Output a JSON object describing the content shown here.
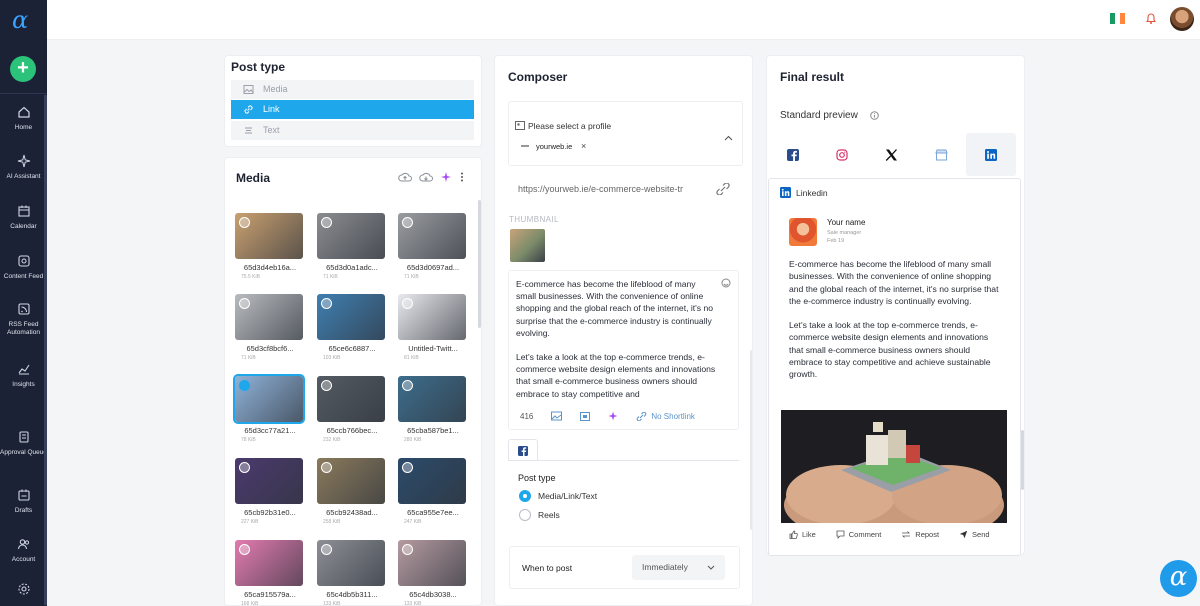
{
  "sidebar": {
    "add_symbol": "+",
    "items": [
      {
        "label": "Home",
        "icon": "home-icon"
      },
      {
        "label": "AI Assistant",
        "icon": "sparkle-icon"
      },
      {
        "label": "Calendar",
        "icon": "calendar-icon"
      },
      {
        "label": "Content Feed",
        "icon": "feed-icon"
      },
      {
        "label": "RSS Feed Automation",
        "icon": "rss-icon"
      },
      {
        "label": "Insights",
        "icon": "chart-icon"
      },
      {
        "label": "Approval Queue",
        "icon": "approval-icon"
      },
      {
        "label": "Drafts",
        "icon": "drafts-icon"
      },
      {
        "label": "Account",
        "icon": "account-icon"
      }
    ]
  },
  "post_type": {
    "title": "Post type",
    "options": [
      {
        "label": "Media",
        "active": false
      },
      {
        "label": "Link",
        "active": true
      },
      {
        "label": "Text",
        "active": false
      }
    ]
  },
  "media": {
    "title": "Media",
    "items": [
      {
        "name": "65d3d4eb16a...",
        "size": "75.5 KiB",
        "color": "#c9a070"
      },
      {
        "name": "65d3d0a1adc...",
        "size": "71 KiB",
        "color": "#8a8c90"
      },
      {
        "name": "65d3d0697ad...",
        "size": "71 KiB",
        "color": "#9a9ca0"
      },
      {
        "name": "65d3cf8bcf6...",
        "size": "71 KiB",
        "color": "#b8bbbf"
      },
      {
        "name": "65ce6c6887...",
        "size": "103 KiB",
        "color": "#3f7fb0"
      },
      {
        "name": "Untitled-Twitt...",
        "size": "81 KiB",
        "color": "#e9e9ee"
      },
      {
        "name": "65d3cc77a21...",
        "size": "78 KiB",
        "color": "#8fb2d8",
        "selected": true
      },
      {
        "name": "65ccb766bec...",
        "size": "232 KiB",
        "color": "#555b63"
      },
      {
        "name": "65cba587be1...",
        "size": "280 KiB",
        "color": "#3d6d8c"
      },
      {
        "name": "65cb92b31e0...",
        "size": "227 KiB",
        "color": "#4b3a6e"
      },
      {
        "name": "65cb92438ad...",
        "size": "258 KiB",
        "color": "#8a7a5c"
      },
      {
        "name": "65ca955e7ee...",
        "size": "247 KiB",
        "color": "#2c4b6a"
      },
      {
        "name": "65ca915579a...",
        "size": "168 KiB",
        "color": "#e27bb0"
      },
      {
        "name": "65c4db5b311...",
        "size": "133 KiB",
        "color": "#8c8f95"
      },
      {
        "name": "65c4db3038...",
        "size": "133 KiB",
        "color": "#b49aa0"
      }
    ]
  },
  "composer": {
    "title": "Composer",
    "profile_prompt": "Please select a profile",
    "profile_chip": "yourweb.ie",
    "chip_remove": "×",
    "url": "https://yourweb.ie/e-commerce-website-tr",
    "thumbnail_label": "THUMBNAIL",
    "text_paragraphs": [
      "E-commerce has become the lifeblood of many small businesses. With the convenience of online shopping and the global reach of the internet, it's no surprise that the e-commerce industry is continually evolving.",
      "Let's take a look at the top e-commerce trends, e-commerce website design elements and innovations that small e-commerce business owners should embrace to stay competitive and"
    ],
    "char_count": "416",
    "shortlink_label": "No Shortlink",
    "post_type_label": "Post type",
    "post_type_options": [
      {
        "label": "Media/Link/Text",
        "selected": true
      },
      {
        "label": "Reels",
        "selected": false
      }
    ],
    "when_label": "When to post",
    "when_value": "Immediately"
  },
  "final_result": {
    "title": "Final result",
    "preview_label": "Standard preview",
    "network_label": "Linkedin",
    "author_name": "Your name",
    "author_role": "Sale manager",
    "post_date": "Feb 19",
    "paragraphs": [
      "E-commerce has become the lifeblood of many small businesses. With the convenience of online shopping and the global reach of the internet, it's no surprise that the e-commerce industry is continually evolving.",
      "Let's take a look at the top e-commerce trends, e-commerce website design elements and innovations that small e-commerce business owners should embrace to stay competitive and achieve sustainable growth."
    ],
    "actions": [
      "Like",
      "Comment",
      "Repost",
      "Send"
    ]
  },
  "colors": {
    "accent": "#1fa7ec",
    "sidebar": "#1b2235",
    "add_button": "#2bc27a",
    "linkedin": "#0a66c2",
    "facebook": "#1877f2",
    "instagram": "#e1306c"
  }
}
